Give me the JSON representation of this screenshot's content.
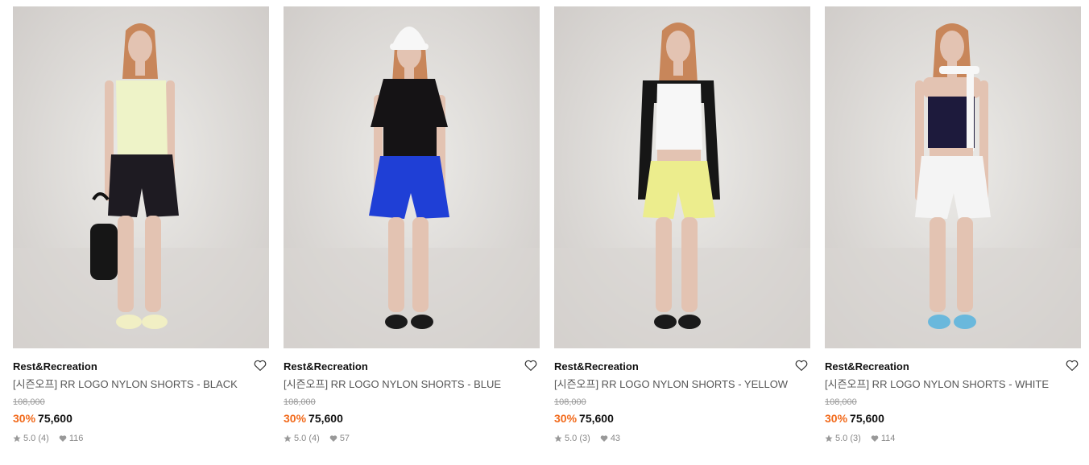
{
  "products": [
    {
      "brand": "Rest&Recreation",
      "name": "[시즌오프] RR LOGO NYLON SHORTS - BLACK",
      "original_price": "108,000",
      "discount": "30%",
      "price": "75,600",
      "rating": "5.0",
      "review_count": "(4)",
      "likes": "116",
      "shorts_color": "#1e1b22",
      "top_color": "#eef3c8",
      "footwear_color": "#f1efc4",
      "image_icon": "model-photo-black-shorts"
    },
    {
      "brand": "Rest&Recreation",
      "name": "[시즌오프] RR LOGO NYLON SHORTS - BLUE",
      "original_price": "108,000",
      "discount": "30%",
      "price": "75,600",
      "rating": "5.0",
      "review_count": "(4)",
      "likes": "57",
      "shorts_color": "#1f3fd6",
      "top_color": "#151315",
      "footwear_color": "#1a1a1a",
      "image_icon": "model-photo-blue-shorts"
    },
    {
      "brand": "Rest&Recreation",
      "name": "[시즌오프] RR LOGO NYLON SHORTS - YELLOW",
      "original_price": "108,000",
      "discount": "30%",
      "price": "75,600",
      "rating": "5.0",
      "review_count": "(3)",
      "likes": "43",
      "shorts_color": "#eced8d",
      "top_color": "#f7f7f7",
      "footwear_color": "#1a1a1a",
      "image_icon": "model-photo-yellow-shorts"
    },
    {
      "brand": "Rest&Recreation",
      "name": "[시즌오프] RR LOGO NYLON SHORTS - WHITE",
      "original_price": "108,000",
      "discount": "30%",
      "price": "75,600",
      "rating": "5.0",
      "review_count": "(3)",
      "likes": "114",
      "shorts_color": "#f4f4f4",
      "top_color": "#1d1a3c",
      "footwear_color": "#6ab8dc",
      "image_icon": "model-photo-white-shorts"
    }
  ],
  "colors": {
    "discount": "#f26a1b",
    "backdrop": "#e3e0dd",
    "skin": "#e3c3b2",
    "hair": "#c8865a"
  }
}
